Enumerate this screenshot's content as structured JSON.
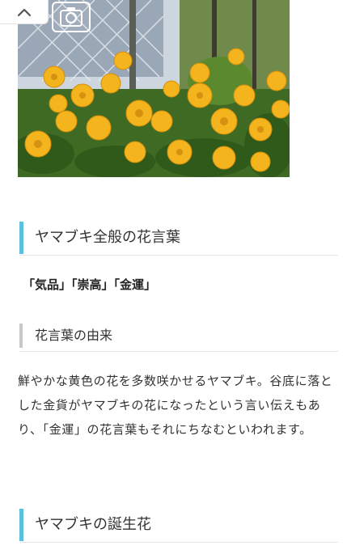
{
  "hero": {
    "alt": "ヤマブキの花の写真",
    "colors": {
      "flower": "#f2b21c",
      "leaf": "#4f7a2a",
      "sky": "#dfe7f0"
    }
  },
  "nav": {
    "collapse_icon": "chevron-up-icon",
    "camera_icon": "camera-icon"
  },
  "section1": {
    "heading": "ヤマブキ全般の花言葉",
    "keywords": "「気品」「崇高」「金運」"
  },
  "section1_sub": {
    "heading": "花言葉の由来",
    "body": "鮮やかな黄色の花を多数咲かせるヤマブキ。谷底に落とした金貨がヤマブキの花になったという言い伝えもあり、「金運」の花言葉もそれにちなむといわれます。"
  },
  "section2": {
    "heading": "ヤマブキの誕生花"
  },
  "colors": {
    "accent": "#5bc0de",
    "subheading_bar": "#c8c8c8",
    "text": "#333333"
  }
}
